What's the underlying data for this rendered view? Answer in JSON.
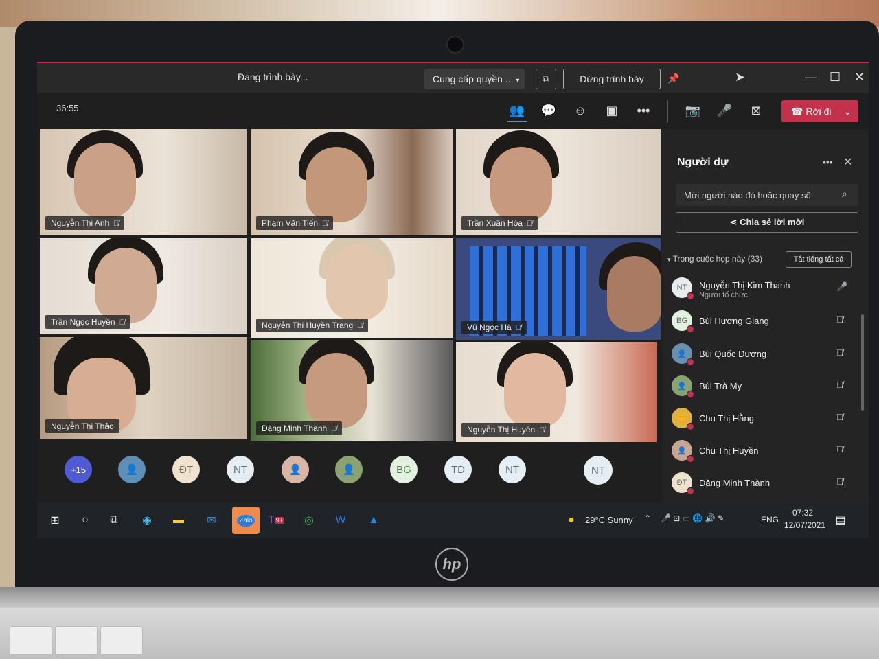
{
  "presenting": {
    "label": "Đang trình bày...",
    "grant_control": "Cung cấp quyền ...",
    "stop_presenting": "Dừng trình bày"
  },
  "call": {
    "timer": "36:55",
    "leave": "Rời đi"
  },
  "tiles": [
    {
      "name": "Nguyễn Thị Anh"
    },
    {
      "name": "Phạm Văn Tiến"
    },
    {
      "name": "Trần Xuân Hòa"
    },
    {
      "name": "Trần Ngọc Huyền"
    },
    {
      "name": "Nguyễn Thị Huyền Trang"
    },
    {
      "name": "Vũ Ngọc Hà"
    },
    {
      "name": "Nguyễn Thị Thảo"
    },
    {
      "name": "Đặng Minh Thành"
    },
    {
      "name": "Nguyễn Thị Huyền"
    }
  ],
  "avatar_row": [
    "+15",
    "",
    "ĐT",
    "NT",
    "",
    "",
    "BG",
    "TD",
    "NT",
    "NT"
  ],
  "panel": {
    "title": "Người dự",
    "search_placeholder": "Mời người nào đó hoặc quay số",
    "share_invite": "Chia sẻ lời mời",
    "section_label": "Trong cuộc họp này (33)",
    "mute_all": "Tắt tiếng tất cả",
    "participants": [
      {
        "initials": "NT",
        "name": "Nguyễn Thị Kim Thanh",
        "role": "Người tổ chức"
      },
      {
        "initials": "BG",
        "name": "Bùi Hương Giang",
        "role": ""
      },
      {
        "initials": "",
        "name": "Bùi Quốc Dương",
        "role": ""
      },
      {
        "initials": "",
        "name": "Bùi Trà My",
        "role": ""
      },
      {
        "initials": "",
        "name": "Chu Thị Hằng",
        "role": ""
      },
      {
        "initials": "",
        "name": "Chu Thị Huyền",
        "role": ""
      },
      {
        "initials": "ĐT",
        "name": "Đặng Minh Thành",
        "role": ""
      }
    ]
  },
  "taskbar": {
    "zalo": "Zalo",
    "teams_badge": "9+",
    "weather": "29°C  Sunny",
    "language": "ENG",
    "time": "07:32",
    "date": "12/07/2021"
  },
  "brand": "hp"
}
